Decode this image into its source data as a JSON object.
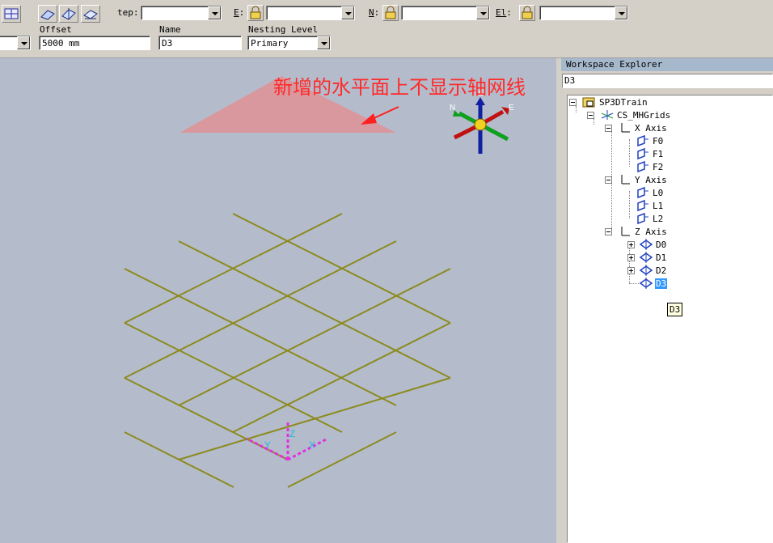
{
  "toolbar": {
    "step_label": "tep:",
    "e_label": "E",
    "n_label": "N",
    "el_label": "El",
    "offset_label": "Offset",
    "offset_value": "5000 mm",
    "name_label": "Name",
    "name_value": "D3",
    "nesting_label": "Nesting Level",
    "nesting_value": "Primary"
  },
  "viewport": {
    "annotation": "新增的水平面上不显示轴网线",
    "compass": {
      "north": "N",
      "east": "E",
      "up": "El"
    },
    "axes": {
      "x": "X",
      "y": "Y",
      "z": "Z"
    }
  },
  "explorer": {
    "title": "Workspace Explorer",
    "search_value": "D3",
    "tree": {
      "root": "SP3DTrain",
      "grid_system": "CS_MHGrids",
      "x_axis": "X Axis",
      "x_items": [
        "F0",
        "F1",
        "F2"
      ],
      "y_axis": "Y Axis",
      "y_items": [
        "L0",
        "L1",
        "L2"
      ],
      "z_axis": "Z Axis",
      "z_items": [
        "D0",
        "D1",
        "D2",
        "D3"
      ]
    },
    "tooltip": "D3"
  },
  "colors": {
    "viewport_bg": "#b4bccc",
    "grid_line": "#8c8a1e",
    "annotation": "#ff2a2a",
    "selection": "#3399ff"
  }
}
